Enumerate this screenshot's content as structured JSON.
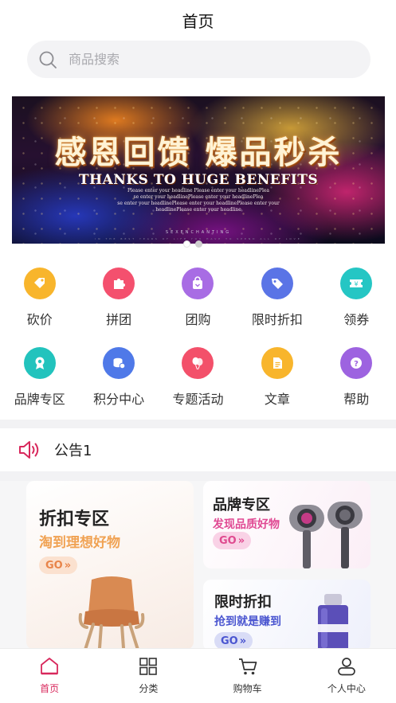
{
  "header": {
    "title": "首页"
  },
  "search": {
    "placeholder": "商品搜索"
  },
  "banner": {
    "headline": "感恩回馈 爆品秒杀",
    "subtitle": "THANKS TO HUGE BENEFITS",
    "fine_lines": [
      "Please enter your headline Please enter your headlinePlea",
      "se enter your headlinePlease enter your headlinePlea",
      "se enter your headlinePlease enter your headlinePlease enter your",
      "headlinePlease enter your headline"
    ],
    "brand": "SEXENCHANTING",
    "tagline": "IN THE BEST YEARS OF LIFE YOU HAVE TO SPEND ALL OF LOVE",
    "slide_count": 2,
    "active_slide": 0
  },
  "grid": {
    "rows": [
      [
        {
          "label": "砍价",
          "icon": "price-tag-icon",
          "color": "#f8b52c"
        },
        {
          "label": "拼团",
          "icon": "puzzle-icon",
          "color": "#f4506e"
        },
        {
          "label": "团购",
          "icon": "shopping-bag-icon",
          "color": "#a86ce4"
        },
        {
          "label": "限时折扣",
          "icon": "discount-tag-icon",
          "color": "#5a74e6"
        },
        {
          "label": "领券",
          "icon": "coupon-icon",
          "color": "#25c6c4"
        }
      ],
      [
        {
          "label": "品牌专区",
          "icon": "badge-icon",
          "color": "#22c3bd"
        },
        {
          "label": "积分中心",
          "icon": "coins-icon",
          "color": "#4f79e8"
        },
        {
          "label": "专题活动",
          "icon": "balloons-icon",
          "color": "#f3506a"
        },
        {
          "label": "文章",
          "icon": "document-icon",
          "color": "#f8b52c"
        },
        {
          "label": "帮助",
          "icon": "help-icon",
          "color": "#9d63e0"
        }
      ]
    ]
  },
  "notice": {
    "text": "公告1",
    "icon": "speaker-icon",
    "color": "#d8285c"
  },
  "promo": {
    "discount": {
      "title": "折扣专区",
      "subtitle": "淘到理想好物",
      "go": "GO"
    },
    "brand": {
      "title": "品牌专区",
      "subtitle": "发现品质好物",
      "go": "GO"
    },
    "flash": {
      "title": "限时折扣",
      "subtitle": "抢到就是赚到",
      "go": "GO"
    }
  },
  "tabbar": {
    "accent": "#d8285c",
    "tabs": [
      {
        "label": "首页",
        "icon": "home-icon",
        "active": true
      },
      {
        "label": "分类",
        "icon": "category-icon",
        "active": false
      },
      {
        "label": "购物车",
        "icon": "cart-icon",
        "active": false
      },
      {
        "label": "个人中心",
        "icon": "user-icon",
        "active": false
      }
    ]
  }
}
